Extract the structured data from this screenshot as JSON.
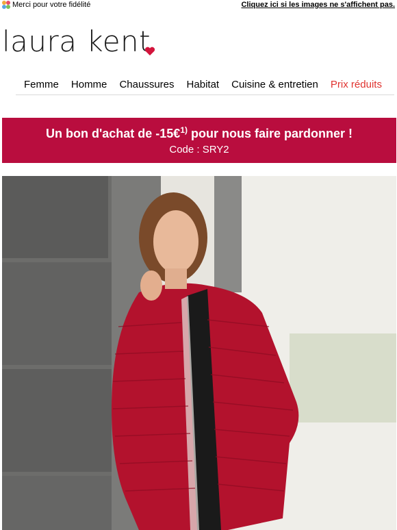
{
  "header": {
    "greeting": "Merci pour votre fidélité",
    "images_link": "Cliquez ici si les images ne s'affichent pas."
  },
  "logo": {
    "text": "laura kent"
  },
  "nav": {
    "items": [
      {
        "label": "Femme"
      },
      {
        "label": "Homme"
      },
      {
        "label": "Chaussures"
      },
      {
        "label": "Habitat"
      },
      {
        "label": "Cuisine & entretien"
      },
      {
        "label": "Prix réduits"
      }
    ]
  },
  "banner": {
    "title_main": "Un bon d'achat de -15€",
    "title_sup": "1)",
    "title_end": " pour nous faire pardonner !",
    "code": "Code : SRY2"
  },
  "colors": {
    "brand_red": "#b90d3e",
    "sale_red": "#e0332f",
    "heart": "#d3143c"
  }
}
